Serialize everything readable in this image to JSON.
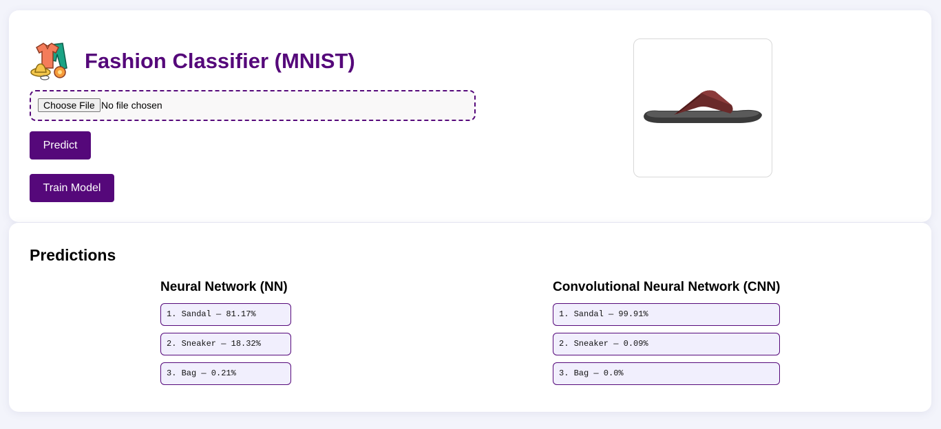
{
  "header": {
    "title": "Fashion Classifier (MNIST)",
    "logo_icon": "clothes-icon"
  },
  "upload": {
    "button_label": "Choose File",
    "status": "No file chosen"
  },
  "actions": {
    "predict_label": "Predict",
    "train_label": "Train Model"
  },
  "preview": {
    "icon": "sandal-image"
  },
  "predictions": {
    "heading": "Predictions",
    "models": [
      {
        "title": "Neural Network (NN)",
        "results": [
          "1. Sandal — 81.17%",
          "2. Sneaker — 18.32%",
          "3. Bag — 0.21%"
        ]
      },
      {
        "title": "Convolutional Neural Network (CNN)",
        "results": [
          "1. Sandal — 99.91%",
          "2. Sneaker — 0.09%",
          "3. Bag — 0.0%"
        ]
      }
    ]
  },
  "colors": {
    "accent": "#55087a",
    "background": "#f3f4fb",
    "prediction_bg": "#f1effd"
  }
}
